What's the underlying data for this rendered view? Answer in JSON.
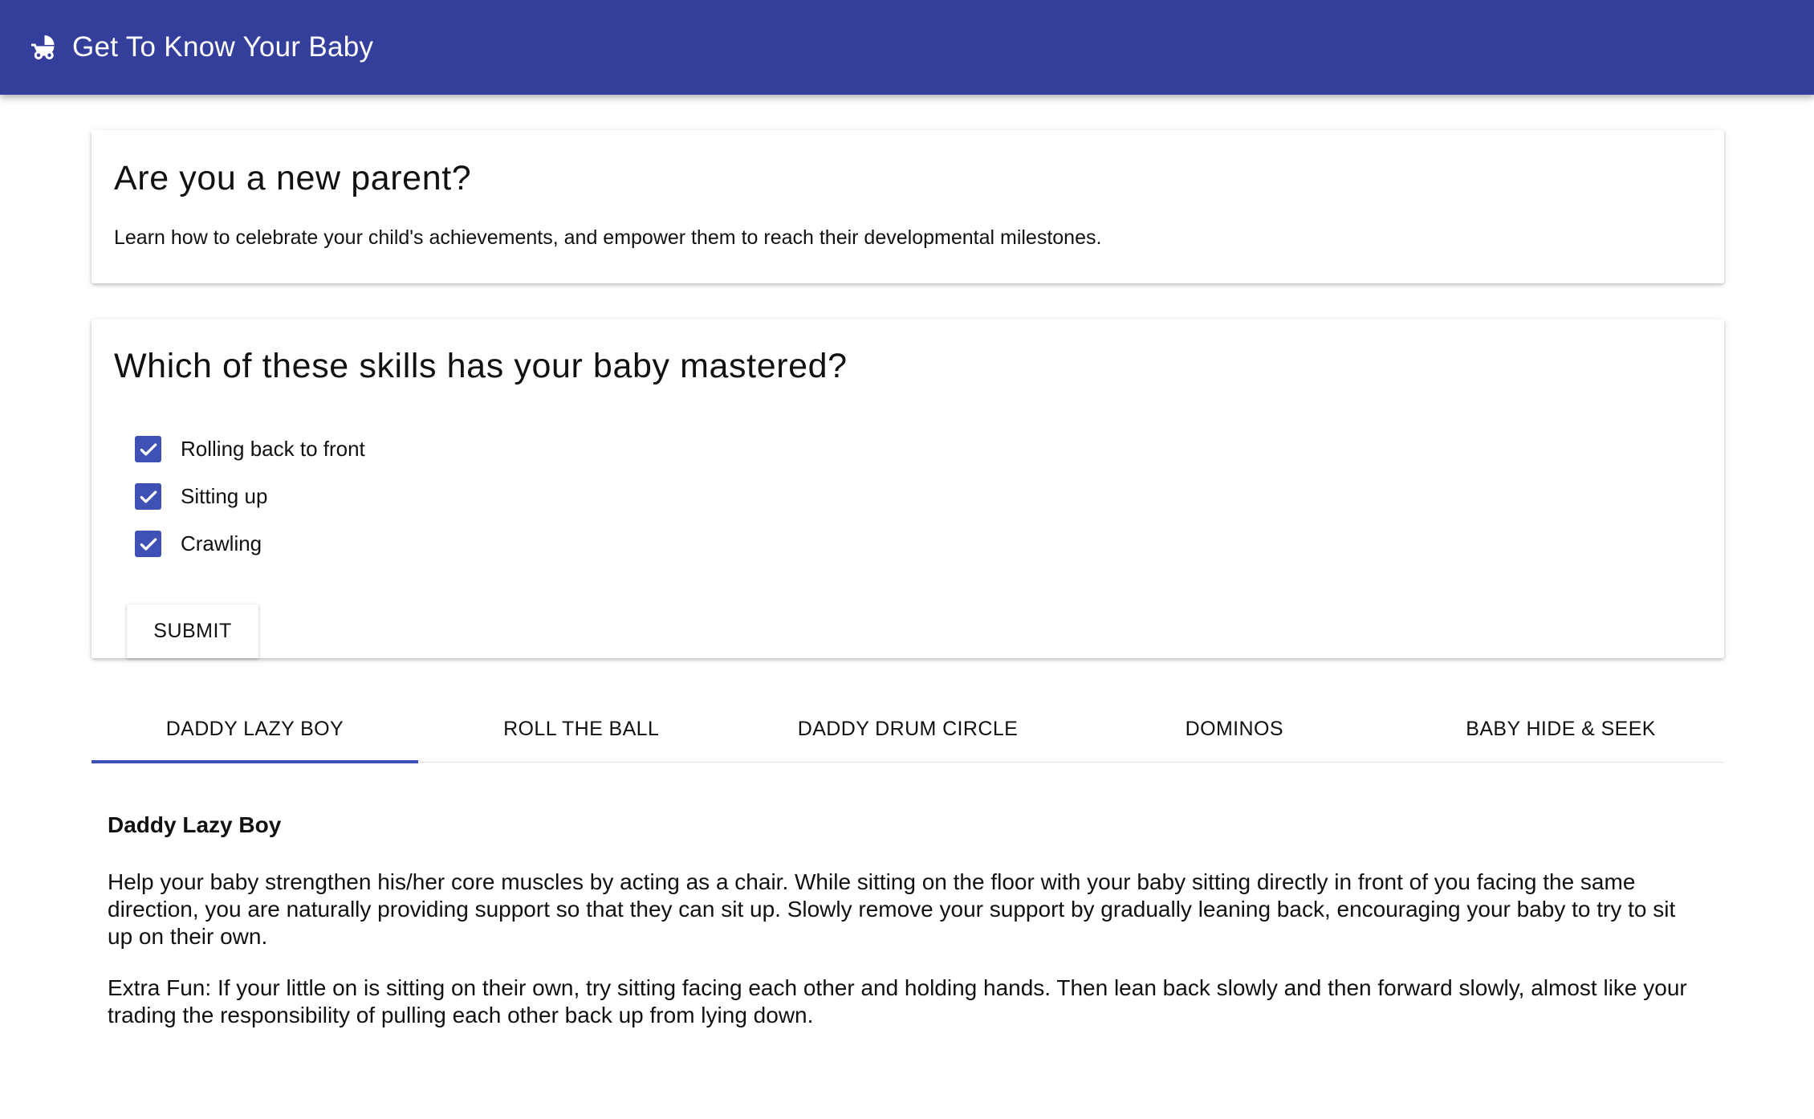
{
  "app": {
    "title": "Get To Know Your Baby",
    "logo_icon": "baby-stroller-icon"
  },
  "intro": {
    "heading": "Are you a new parent?",
    "text": "Learn how to celebrate your child's achievements, and empower them to reach their developmental milestones."
  },
  "skills_form": {
    "heading": "Which of these skills has your baby mastered?",
    "skills": [
      {
        "label": "Rolling back to front",
        "checked": true
      },
      {
        "label": "Sitting up",
        "checked": true
      },
      {
        "label": "Crawling",
        "checked": true
      }
    ],
    "submit_label": "SUBMIT"
  },
  "tabs": [
    {
      "label": "DADDY LAZY BOY",
      "active": true
    },
    {
      "label": "ROLL THE BALL",
      "active": false
    },
    {
      "label": "DADDY DRUM CIRCLE",
      "active": false
    },
    {
      "label": "DOMINOS",
      "active": false
    },
    {
      "label": "BABY HIDE & SEEK",
      "active": false
    }
  ],
  "activity": {
    "title": "Daddy Lazy Boy",
    "description": "Help your baby strengthen his/her core muscles by acting as a chair. While sitting on the floor with your baby sitting directly in front of you facing the same direction, you are naturally providing support so that they can sit up. Slowly remove your support by gradually leaning back, encouraging your baby to try to sit up on their own.",
    "extra": "Extra Fun: If your little on is sitting on their own, try sitting facing each other and holding hands. Then lean back slowly and then forward slowly, almost like your trading the responsibility of pulling each other back up from lying down."
  },
  "colors": {
    "primary": "#343f9b",
    "accent": "#3f51b5",
    "text": "#111111"
  }
}
